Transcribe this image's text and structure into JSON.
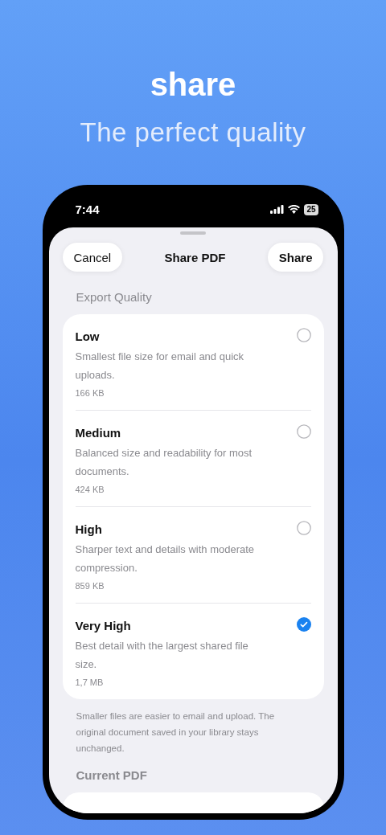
{
  "headline": "share",
  "subheadline": "The perfect quality",
  "status_bar": {
    "time": "7:44",
    "battery": "25"
  },
  "sheet": {
    "cancel": "Cancel",
    "title": "Share PDF",
    "share": "Share"
  },
  "section_title": "Export Quality",
  "options": [
    {
      "title": "Low",
      "description": "Smallest file size for email and quick uploads.",
      "size": "166 KB",
      "selected": false
    },
    {
      "title": "Medium",
      "description": "Balanced size and readability for most documents.",
      "size": "424 KB",
      "selected": false
    },
    {
      "title": "High",
      "description": "Sharper text and details with moderate compression.",
      "size": "859 KB",
      "selected": false
    },
    {
      "title": "Very High",
      "description": "Best detail with the largest shared file size.",
      "size": "1,7 MB",
      "selected": true
    }
  ],
  "footnote": "Smaller files are easier to email and upload. The original document saved in your library stays unchanged.",
  "section_2_title": "Current PDF"
}
